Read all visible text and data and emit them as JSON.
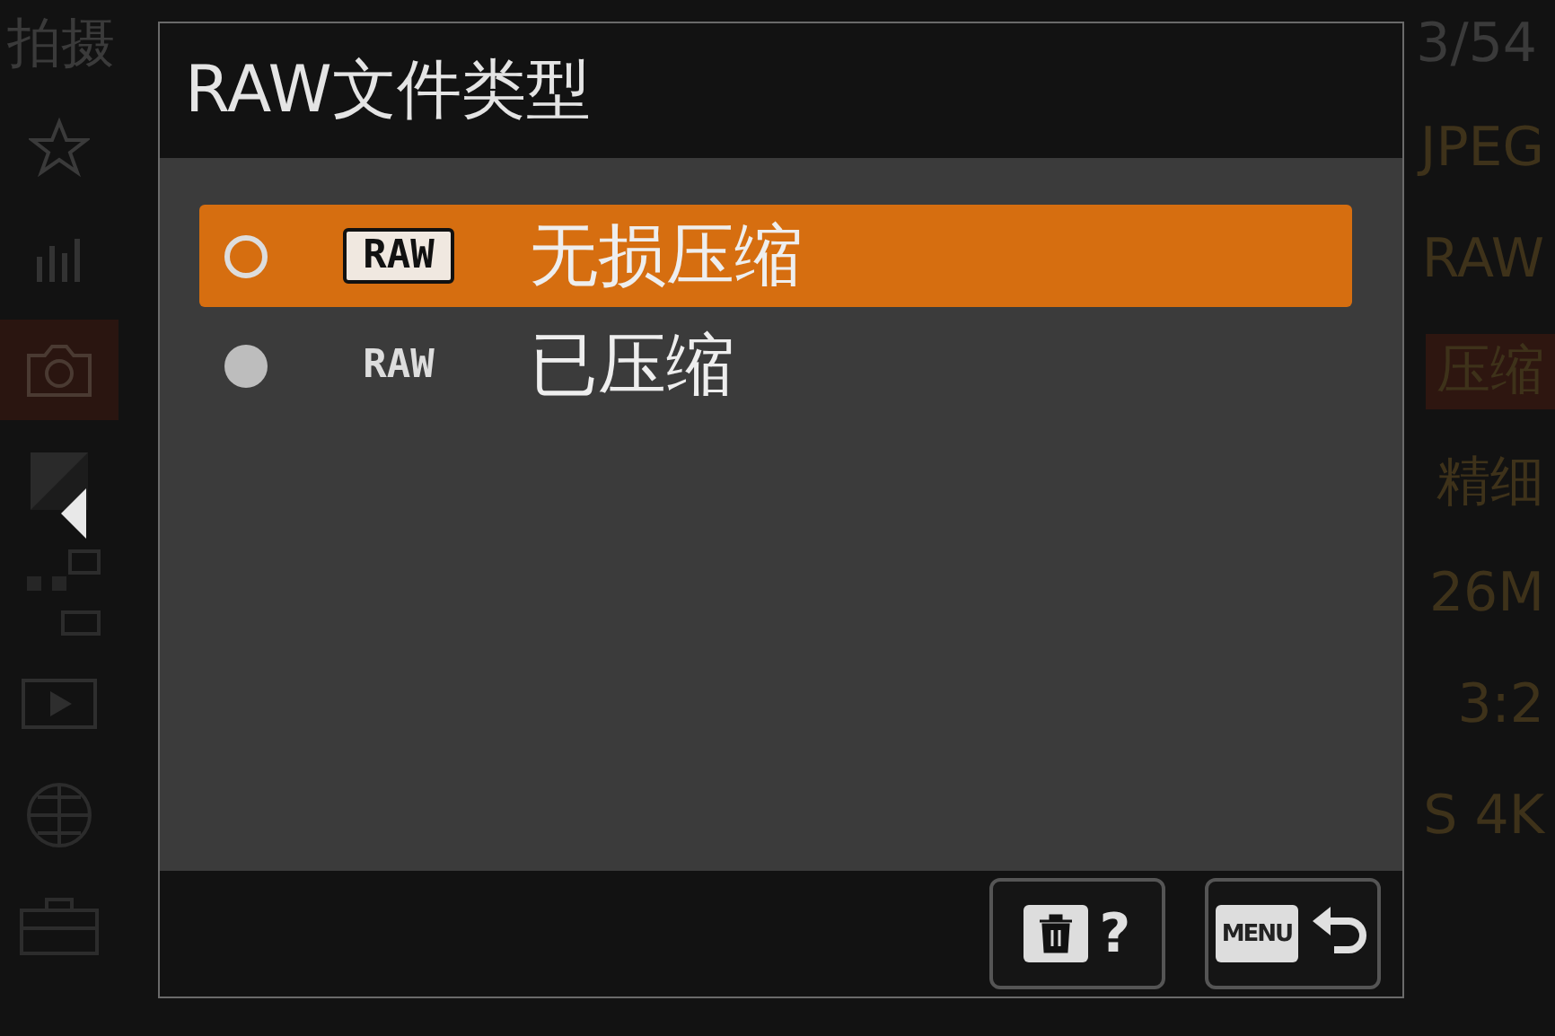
{
  "background": {
    "breadcrumb": "拍摄",
    "page": "3/54",
    "sidebar": [
      {
        "kind": "star",
        "selected": false
      },
      {
        "kind": "bars",
        "selected": false
      },
      {
        "kind": "camera",
        "selected": true
      },
      {
        "kind": "exposure",
        "selected": false
      },
      {
        "kind": "afmf",
        "selected": false
      },
      {
        "kind": "play",
        "selected": false
      },
      {
        "kind": "globe",
        "selected": false
      },
      {
        "kind": "toolbox",
        "selected": false
      }
    ],
    "values": [
      {
        "text": "JPEG",
        "selected": false
      },
      {
        "text": "RAW",
        "selected": false
      },
      {
        "text": "压缩",
        "selected": true
      },
      {
        "text": "精细",
        "selected": false
      },
      {
        "text": "26M",
        "selected": false
      },
      {
        "text": "3:2",
        "selected": false
      },
      {
        "text": "S 4K",
        "selected": false
      }
    ]
  },
  "dialog": {
    "title": "RAW文件类型",
    "options": [
      {
        "badge": "RAW",
        "boxed": true,
        "label": "无损压缩",
        "selected": true
      },
      {
        "badge": "RAW",
        "boxed": false,
        "label": "已压缩",
        "selected": false
      }
    ],
    "buttons": [
      {
        "kind": "delete-help",
        "text": "?"
      },
      {
        "kind": "menu-back",
        "text": "MENU"
      }
    ]
  }
}
